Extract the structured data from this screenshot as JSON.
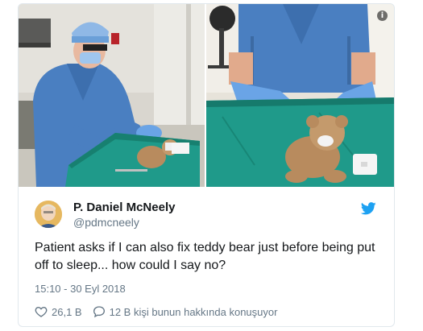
{
  "tweet": {
    "display_name": "P. Daniel McNeely",
    "handle": "@pdmcneely",
    "text": "Patient asks if I can also fix teddy bear just before being put\noff to sleep... how could I say no?",
    "timestamp": "15:10 - 30 Eyl 2018",
    "likes": "26,1 B",
    "replies_text": "12 B kişi bunun hakkında konuşuyor"
  },
  "icons": {
    "info": "info-icon",
    "bird": "twitter-bird-icon",
    "like": "heart-icon",
    "reply": "speech-bubble-icon"
  },
  "colors": {
    "text_primary": "#14171a",
    "text_secondary": "#657786",
    "twitter_blue": "#1da1f2",
    "scrub_blue": "#4a7fc1",
    "drape_teal": "#1f9a8a"
  }
}
